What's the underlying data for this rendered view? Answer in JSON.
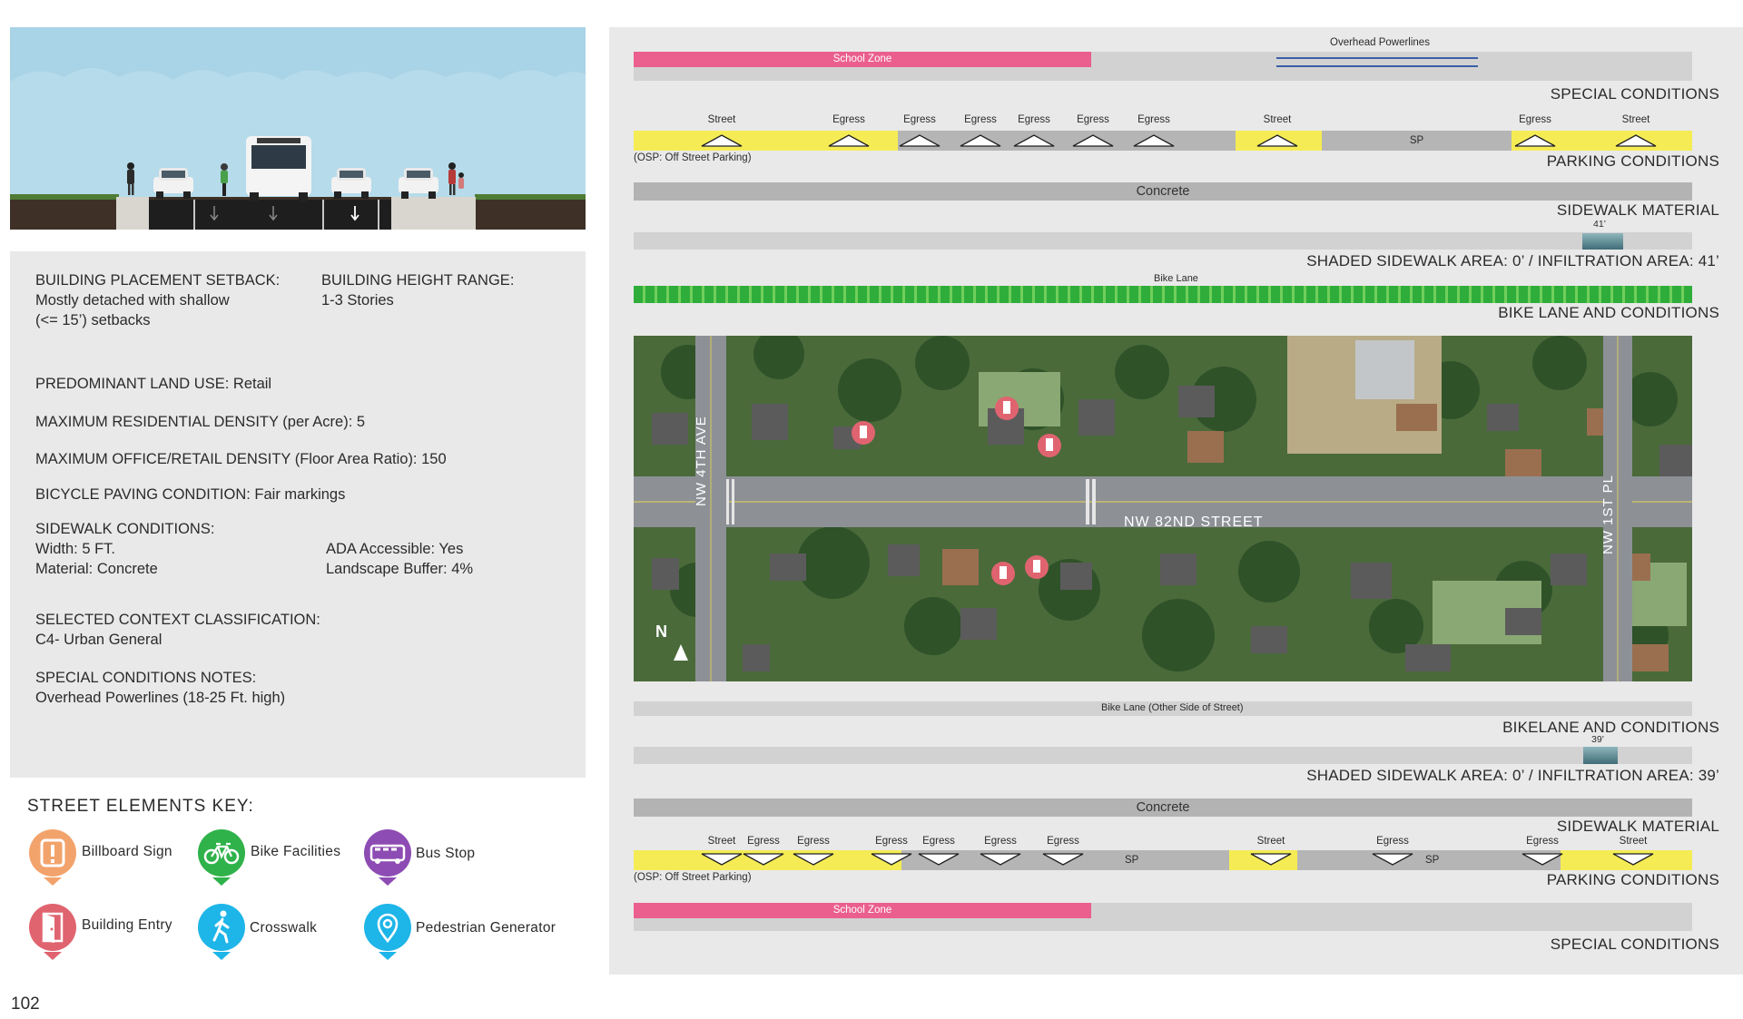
{
  "info": {
    "setback_heading": "BUILDING PLACEMENT SETBACK:",
    "setback_value": "Mostly detached with shallow\n(<= 15’) setbacks",
    "height_heading": "BUILDING HEIGHT RANGE:",
    "height_value": "1-3 Stories",
    "land_use": "PREDOMINANT LAND USE: Retail",
    "res_density": "MAXIMUM RESIDENTIAL DENSITY (per Acre): 5",
    "office_density": "MAXIMUM OFFICE/RETAIL DENSITY (Floor Area Ratio): 150",
    "bicycle_paving": "BICYCLE PAVING CONDITION: Fair markings",
    "sidewalk_heading": "SIDEWALK CONDITIONS:",
    "sidewalk_left": "Width: 5 FT.\nMaterial: Concrete",
    "sidewalk_right": "ADA Accessible: Yes\nLandscape Buffer: 4%",
    "context_heading": "SELECTED CONTEXT CLASSIFICATION:",
    "context_value": "C4- Urban General",
    "special_heading": "SPECIAL CONDITIONS NOTES:",
    "special_value": "Overhead Powerlines (18-25 Ft. high)"
  },
  "key": {
    "title": "STREET ELEMENTS KEY:",
    "items": [
      {
        "label": "Billboard Sign",
        "icon": "billboard-sign-icon",
        "color": "#f2a36b"
      },
      {
        "label": "Bike Facilities",
        "icon": "bike-icon",
        "color": "#2fb24a"
      },
      {
        "label": "Bus Stop",
        "icon": "bus-icon",
        "color": "#8d4cb3"
      },
      {
        "label": "Building Entry",
        "icon": "door-icon",
        "color": "#e06470"
      },
      {
        "label": "Crosswalk",
        "icon": "pedestrian-icon",
        "color": "#1eb5e8"
      },
      {
        "label": "Pedestrian Generator",
        "icon": "location-pin-icon",
        "color": "#1eb5e8"
      }
    ]
  },
  "page_number": "102",
  "north": {
    "special_label": "SPECIAL CONDITIONS",
    "school_zone": "School Zone",
    "powerlines": "Overhead Powerlines",
    "parking_label": "PARKING CONDITIONS",
    "osp_note": "(OSP: Off Street Parking)",
    "parking_markers": [
      "Street",
      "Egress",
      "Egress",
      "Egress",
      "Egress",
      "Egress",
      "Egress",
      "Street",
      "Egress",
      "Street"
    ],
    "sp": "SP",
    "concrete": "Concrete",
    "sidewalk_label": "SIDEWALK MATERIAL",
    "shade_value": "41’",
    "shade_label": "SHADED SIDEWALK AREA: 0’ / INFILTRATION AREA: 41’",
    "bike_lane": "Bike Lane",
    "bike_label": "BIKE LANE AND CONDITIONS"
  },
  "map": {
    "street_main": "NW 82ND STREET",
    "street_left": "NW 4TH AVE",
    "street_right": "NW 1ST PL",
    "north_arrow": "N"
  },
  "south": {
    "bike_lane": "Bike Lane (Other Side of Street)",
    "bike_label": "BIKELANE AND CONDITIONS",
    "shade_value": "39’",
    "shade_label": "SHADED SIDEWALK AREA: 0’ / INFILTRATION AREA: 39’",
    "concrete": "Concrete",
    "sidewalk_label": "SIDEWALK MATERIAL",
    "parking_markers": [
      "Street",
      "Egress",
      "Egress",
      "Egress",
      "Egress",
      "Egress",
      "Egress",
      "Street",
      "Egress",
      "Egress",
      "Street"
    ],
    "sp": "SP",
    "sp2": "SP",
    "osp_note": "(OSP: Off Street Parking)",
    "parking_label": "PARKING CONDITIONS",
    "school_zone": "School Zone",
    "special_label": "SPECIAL CONDITIONS"
  }
}
